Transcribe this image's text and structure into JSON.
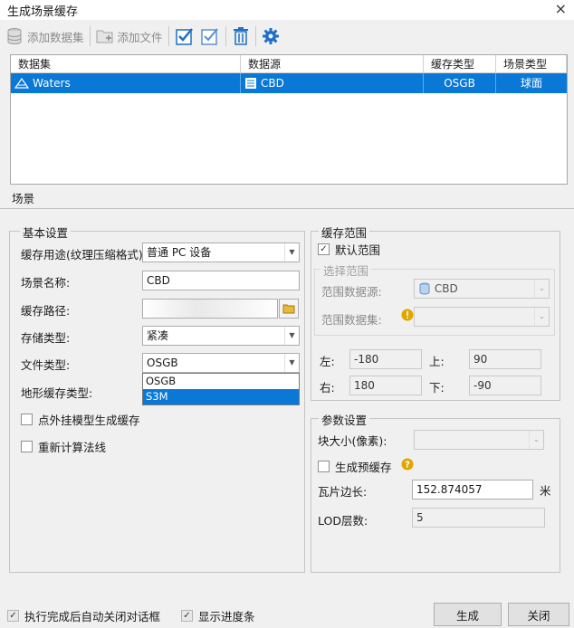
{
  "window": {
    "title": "生成场景缓存",
    "close_glyph": "×"
  },
  "toolbar": {
    "add_dataset": "添加数据集",
    "add_file": "添加文件"
  },
  "grid": {
    "headers": [
      "数据集",
      "数据源",
      "缓存类型",
      "场景类型"
    ],
    "rows": [
      {
        "dataset": "Waters",
        "datasource": "CBD",
        "cache_type": "OSGB",
        "scene_type": "球面"
      }
    ]
  },
  "tab": {
    "label": "场景"
  },
  "basic": {
    "legend": "基本设置",
    "usage_label": "缓存用途(纹理压缩格式)",
    "usage_value": "普通 PC 设备",
    "scene_name_label": "场景名称:",
    "scene_name_value": "CBD",
    "cache_path_label": "缓存路径:",
    "storage_type_label": "存储类型:",
    "storage_type_value": "紧凑",
    "file_type_label": "文件类型:",
    "file_type_value": "OSGB",
    "file_type_options": [
      "OSGB",
      "S3M"
    ],
    "file_type_selected_index": 1,
    "terrain_label": "地形缓存类型:",
    "external_model_label": "点外挂模型生成缓存",
    "recalc_normals_label": "重新计算法线"
  },
  "range": {
    "legend": "缓存范围",
    "default_range_label": "默认范围",
    "default_range_checked": true,
    "select_range_legend": "选择范围",
    "range_datasource_label": "范围数据源:",
    "range_datasource_value": "CBD",
    "range_dataset_label": "范围数据集:",
    "left_label": "左:",
    "left_value": "-180",
    "top_label": "上:",
    "top_value": "90",
    "right_label": "右:",
    "right_value": "180",
    "bottom_label": "下:",
    "bottom_value": "-90"
  },
  "params": {
    "legend": "参数设置",
    "block_size_label": "块大小(像素):",
    "pre_cache_label": "生成预缓存",
    "tile_edge_label": "瓦片边长:",
    "tile_edge_value": "152.874057",
    "tile_edge_unit": "米",
    "lod_label": "LOD层数:",
    "lod_value": "5"
  },
  "footer": {
    "auto_close_label": "执行完成后自动关闭对话框",
    "auto_close_checked": true,
    "show_progress_label": "显示进度条",
    "show_progress_checked": true,
    "generate_button": "生成",
    "close_button": "关闭"
  },
  "colors": {
    "accent": "#0a78d7",
    "icon_blue": "#1f6fc4",
    "warning": "#e0a600"
  }
}
